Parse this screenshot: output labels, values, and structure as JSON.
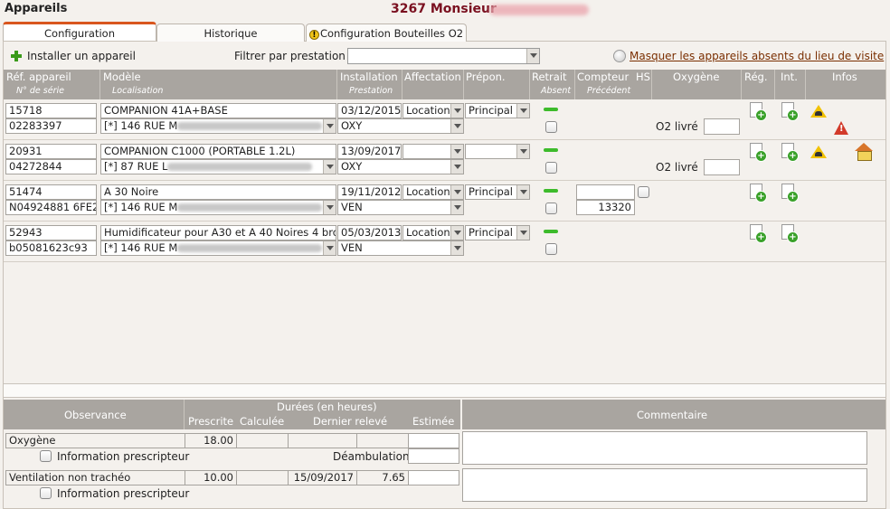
{
  "header": {
    "app_title": "Appareils",
    "patient_title": "3267 Monsieur"
  },
  "tabs": [
    {
      "label": "Configuration",
      "active": true
    },
    {
      "label": "Historique",
      "active": false
    },
    {
      "label": "Configuration Bouteilles O2",
      "active": false,
      "icon": "warning-icon"
    }
  ],
  "toolbar": {
    "install_label": "Installer un appareil",
    "filter_label": "Filtrer par prestation",
    "filter_value": "",
    "hide_absent_link": "Masquer les appareils absents du lieu de visite"
  },
  "grid": {
    "columns": {
      "ref": "Réf. appareil",
      "serial": "N° de série",
      "model": "Modèle",
      "location": "Localisation",
      "installation": "Installation",
      "prestation": "Prestation",
      "affectation": "Affectation",
      "prepon": "Prépon.",
      "retrait": "Retrait",
      "absent": "Absent",
      "compteur": "Compteur",
      "hs": "HS",
      "precedent": "Précédent",
      "oxygene": "Oxygène",
      "reg": "Rég.",
      "int": "Int.",
      "infos": "Infos"
    },
    "rows": [
      {
        "ref": "15718",
        "serial": "02283397",
        "model": "COMPANION 41A+BASE",
        "location_prefix": "[*] 146 RUE M",
        "installation_date": "03/12/2015",
        "prestation": "OXY",
        "affectation": "Location",
        "prepon": "Principal",
        "o2_label": "O2 livré",
        "compteur": "",
        "precedent": "",
        "infos_icons": [
          "worker-icon",
          "alert-icon"
        ]
      },
      {
        "ref": "20931",
        "serial": "04272844",
        "model": "COMPANION C1000  (PORTABLE 1.2L)",
        "location_prefix": "[*] 87 RUE L",
        "installation_date": "13/09/2017",
        "prestation": "OXY",
        "affectation": "",
        "prepon": "",
        "o2_label": "O2 livré",
        "compteur": "",
        "precedent": "",
        "infos_icons": [
          "worker-icon",
          "home-icon"
        ]
      },
      {
        "ref": "51474",
        "serial": "N04924881 6FE2",
        "model": "A 30  Noire",
        "location_prefix": "[*] 146 RUE M",
        "installation_date": "19/11/2012",
        "prestation": "VEN",
        "affectation": "Location",
        "prepon": "Principal",
        "o2_label": "",
        "compteur": "",
        "precedent": "13320",
        "infos_icons": []
      },
      {
        "ref": "52943",
        "serial": "b05081623c93",
        "model": "Humidificateur pour A30 et A 40 Noires 4 bro",
        "location_prefix": "[*] 146 RUE M",
        "installation_date": "05/03/2013",
        "prestation": "VEN",
        "affectation": "Location",
        "prepon": "Principal",
        "o2_label": "",
        "compteur": "",
        "precedent": "",
        "infos_icons": []
      }
    ]
  },
  "observance": {
    "header": "Observance",
    "durations_header": "Durées (en heures)",
    "col_prescrite": "Prescrite",
    "col_calculee": "Calculée",
    "col_dernier": "Dernier relevé",
    "col_estimee": "Estimée",
    "comment_header": "Commentaire",
    "rows": [
      {
        "label": "Oxygène",
        "prescrite": "18.00",
        "calculee": "",
        "dernier_date": "",
        "dernier_value": "",
        "estimee": "",
        "info_label": "Information prescripteur",
        "extra_label": "Déambulation"
      },
      {
        "label": "Ventilation non trachéo",
        "prescrite": "10.00",
        "calculee": "",
        "dernier_date": "15/09/2017",
        "dernier_value": "7.65",
        "estimee": "",
        "info_label": "Information prescripteur",
        "extra_label": ""
      }
    ]
  }
}
